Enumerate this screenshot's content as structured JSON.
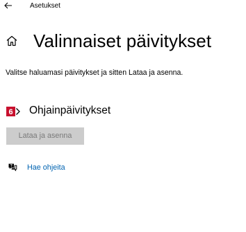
{
  "window": {
    "app_title": "Asetukset",
    "icons": {
      "back": "back-arrow-icon",
      "home": "home-icon",
      "step_badge": "number-badge-icon",
      "help": "help-chat-icon"
    }
  },
  "header": {
    "title": "Valinnaiset päivitykset"
  },
  "main": {
    "description": "Valitse haluamasi päivitykset ja sitten Lataa ja asenna.",
    "section": {
      "step_number": "6",
      "title": "Ohjainpäivitykset"
    },
    "install_button": {
      "label": "Lataa ja asenna",
      "enabled": false
    },
    "help_link": {
      "label": "Hae ohjeita"
    }
  },
  "colors": {
    "link": "#0063b1",
    "badge": "#c8102e",
    "button_disabled_bg": "#cccccc",
    "button_disabled_text": "#7a7a7a"
  }
}
